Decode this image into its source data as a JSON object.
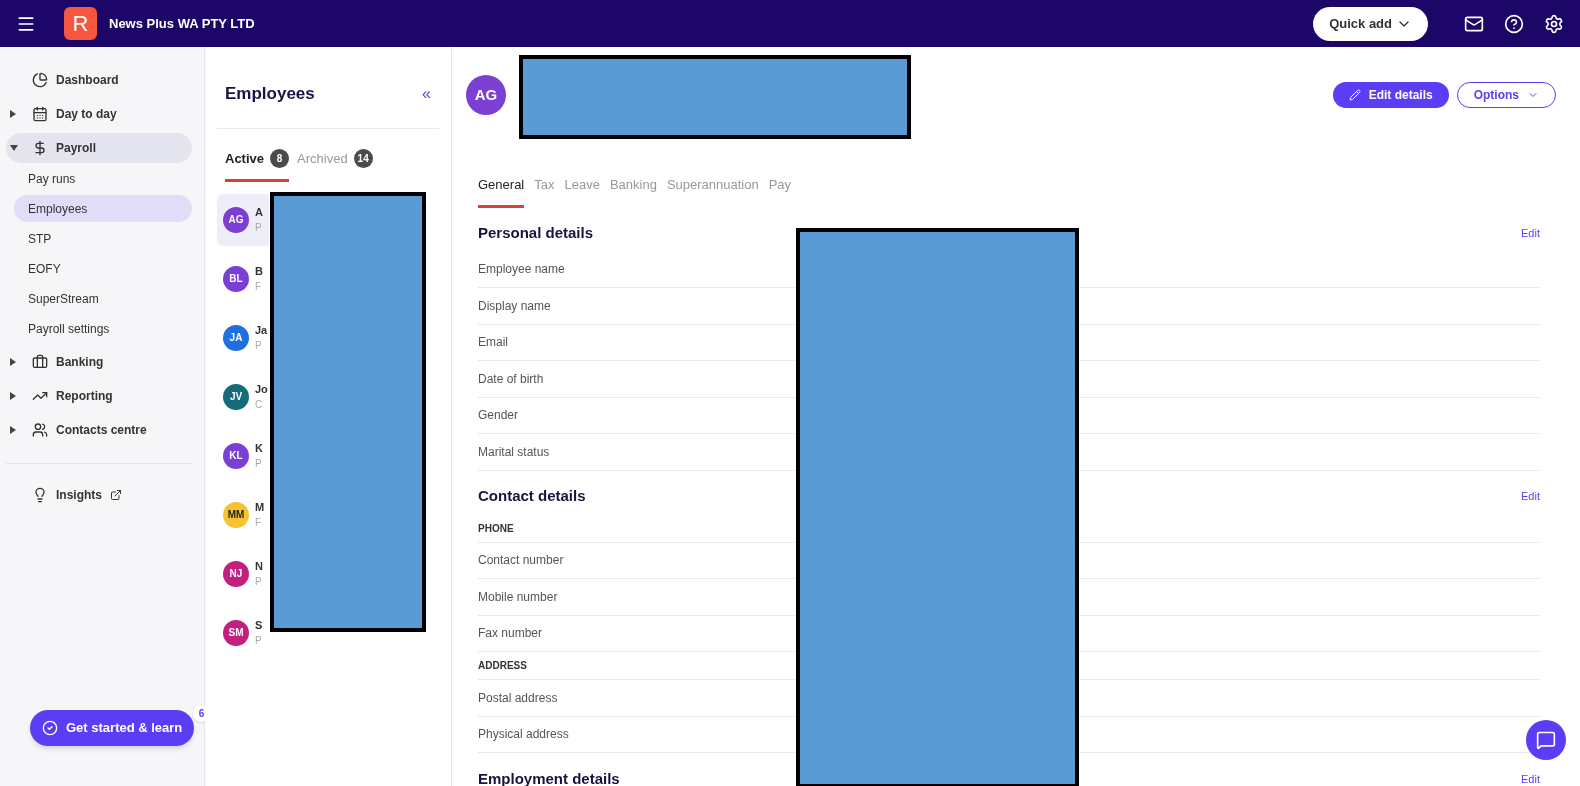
{
  "topbar": {
    "logo": "R",
    "company": "News Plus WA PTY LTD",
    "quick_add": "Quick add"
  },
  "sidebar": {
    "items": [
      {
        "label": "Dashboard",
        "selected": false
      },
      {
        "label": "Day to day",
        "expanded": false,
        "selected": false
      },
      {
        "label": "Payroll",
        "expanded": true,
        "selected": true,
        "children": [
          {
            "label": "Pay runs",
            "selected": false
          },
          {
            "label": "Employees",
            "selected": true
          },
          {
            "label": "STP",
            "selected": false
          },
          {
            "label": "EOFY",
            "selected": false
          },
          {
            "label": "SuperStream",
            "selected": false
          },
          {
            "label": "Payroll settings",
            "selected": false
          }
        ]
      },
      {
        "label": "Banking",
        "expanded": false,
        "selected": false
      },
      {
        "label": "Reporting",
        "expanded": false,
        "selected": false
      },
      {
        "label": "Contacts centre",
        "expanded": false,
        "selected": false
      }
    ],
    "secondary": [
      {
        "label": "Insights",
        "kind": "external"
      }
    ],
    "get_started": {
      "label": "Get started & learn",
      "count": "6"
    }
  },
  "employees": {
    "title": "Employees",
    "collapse": "«",
    "tabs": [
      {
        "label": "Active",
        "count": "8",
        "selected": true
      },
      {
        "label": "Archived",
        "count": "14",
        "selected": false
      }
    ],
    "list": [
      {
        "initials": "AG",
        "color": "#7b3fd4",
        "name": "A",
        "sub": "P",
        "selected": true
      },
      {
        "initials": "BL",
        "color": "#7b3fd4",
        "name": "B",
        "sub": "F",
        "selected": false
      },
      {
        "initials": "JA",
        "color": "#1f6fe0",
        "name": "Ja",
        "sub": "P",
        "selected": false
      },
      {
        "initials": "JV",
        "color": "#156b7a",
        "name": "Jo",
        "sub": "C",
        "selected": false
      },
      {
        "initials": "KL",
        "color": "#7b3fd4",
        "name": "K",
        "sub": "P",
        "selected": false
      },
      {
        "initials": "MM",
        "color": "#f6c22e",
        "name": "M",
        "sub": "F",
        "selected": false
      },
      {
        "initials": "NJ",
        "color": "#c21f7f",
        "name": "N",
        "sub": "P",
        "selected": false
      },
      {
        "initials": "SM",
        "color": "#c21f7f",
        "name": "S",
        "sub": "P",
        "selected": false
      }
    ]
  },
  "detail": {
    "initials": "AG",
    "edit_details": "Edit details",
    "options": "Options",
    "tabs": [
      {
        "label": "General",
        "selected": true
      },
      {
        "label": "Tax",
        "selected": false
      },
      {
        "label": "Leave",
        "selected": false
      },
      {
        "label": "Banking",
        "selected": false
      },
      {
        "label": "Superannuation",
        "selected": false
      },
      {
        "label": "Pay",
        "selected": false
      }
    ],
    "sections": [
      {
        "title": "Personal details",
        "edit": "Edit",
        "groups": [
          {
            "rows": [
              "Employee name",
              "Display name",
              "Email",
              "Date of birth",
              "Gender",
              "Marital status"
            ]
          }
        ]
      },
      {
        "title": "Contact details",
        "edit": "Edit",
        "groups": [
          {
            "heading": "PHONE",
            "rows": [
              "Contact number",
              "Mobile number",
              "Fax number"
            ]
          },
          {
            "heading": "ADDRESS",
            "rows": [
              "Postal address",
              "Physical address"
            ]
          }
        ]
      },
      {
        "title": "Employment details",
        "edit": "Edit"
      }
    ]
  }
}
